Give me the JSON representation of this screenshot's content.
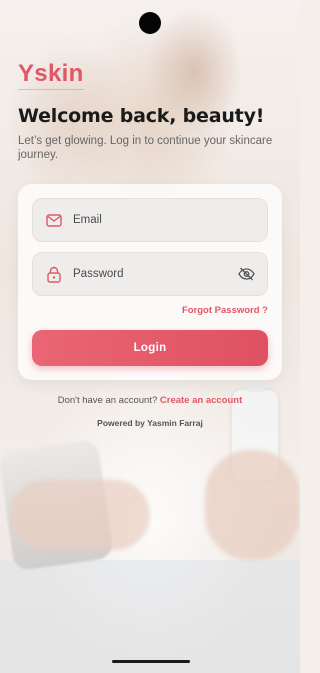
{
  "app": {
    "logo_text": "Yskin",
    "brand_color": "#e05865"
  },
  "header": {
    "title": "Welcome back, beauty!",
    "subtitle": "Let’s get glowing. Log in to continue your skincare journey."
  },
  "form": {
    "email": {
      "placeholder": "Email",
      "value": "",
      "icon": "mail-icon"
    },
    "password": {
      "placeholder": "Password",
      "value": "",
      "icon": "lock-icon",
      "toggle_icon": "eye-off-icon"
    },
    "forgot_label": "Forgot Password ?",
    "login_label": "Login"
  },
  "footer": {
    "signup_prompt": "Don't have an account?",
    "signup_link": "Create an account",
    "powered_by": "Powered by Yasmin Farraj"
  }
}
